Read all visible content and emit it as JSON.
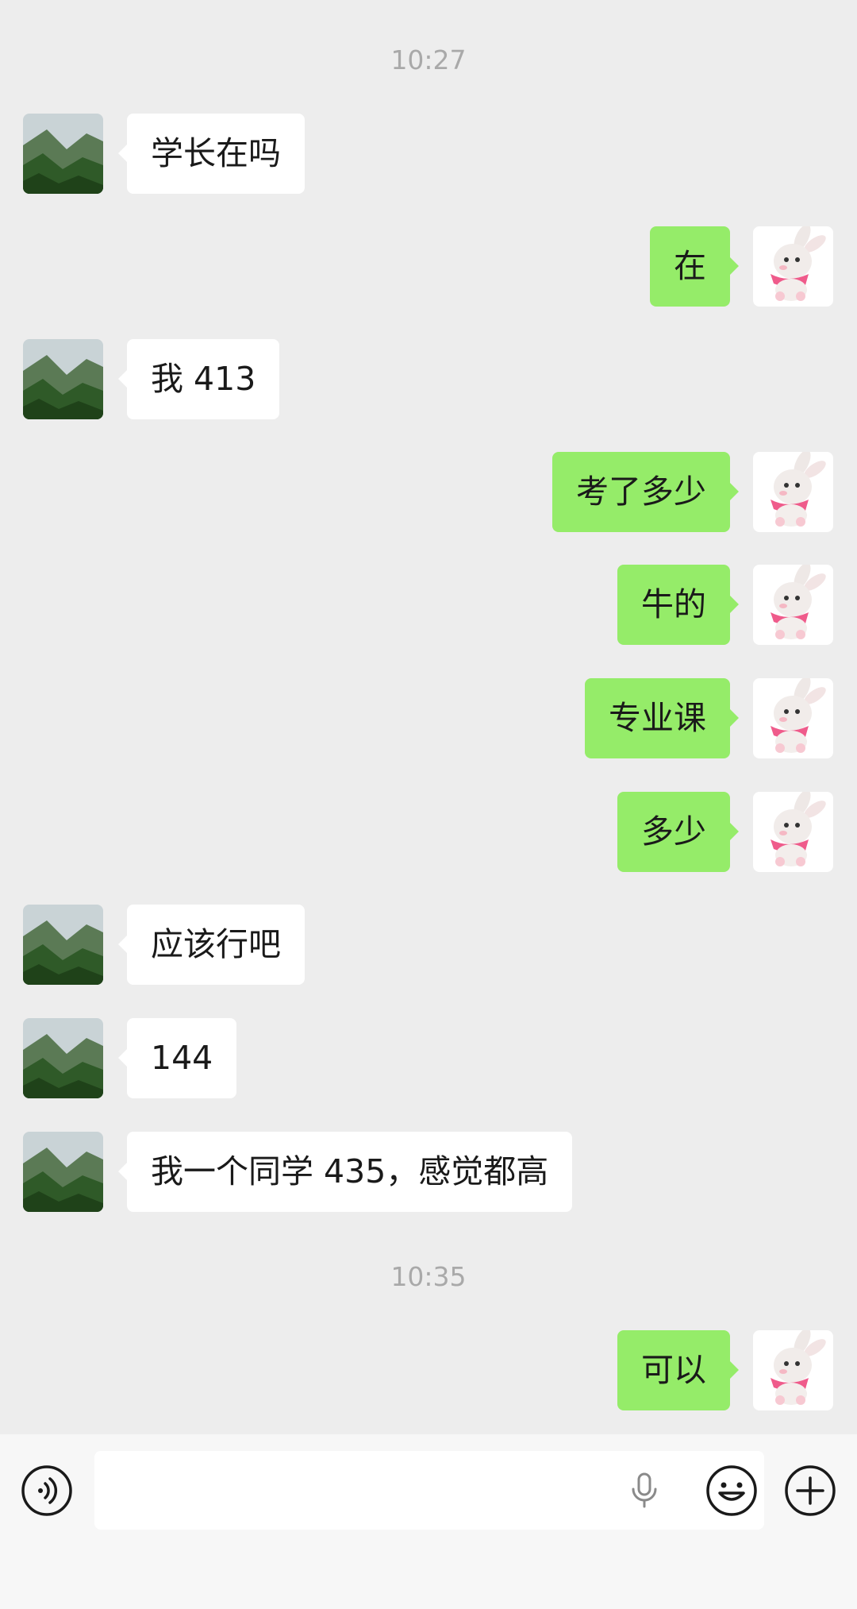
{
  "chat": {
    "times": [
      "10:27",
      "10:35"
    ],
    "messages": [
      {
        "side": "left",
        "text": "学长在吗"
      },
      {
        "side": "right",
        "text": "在"
      },
      {
        "side": "left",
        "text": "我 413"
      },
      {
        "side": "right",
        "text": "考了多少"
      },
      {
        "side": "right",
        "text": "牛的"
      },
      {
        "side": "right",
        "text": "专业课"
      },
      {
        "side": "right",
        "text": "多少"
      },
      {
        "side": "left",
        "text": "应该行吧"
      },
      {
        "side": "left",
        "text": "144"
      },
      {
        "side": "left",
        "text": "我一个同学 435，感觉都高"
      },
      {
        "side": "right",
        "text": "可以"
      }
    ]
  },
  "input_bar": {
    "message_value": "",
    "icons": {
      "voice": "voice-mode-icon",
      "mic": "microphone-icon",
      "emoji": "emoji-icon",
      "more": "plus-icon"
    }
  },
  "colors": {
    "background": "#ededed",
    "outgoing_bubble": "#95ec69",
    "incoming_bubble": "#ffffff",
    "timestamp": "#a9a9a9"
  }
}
